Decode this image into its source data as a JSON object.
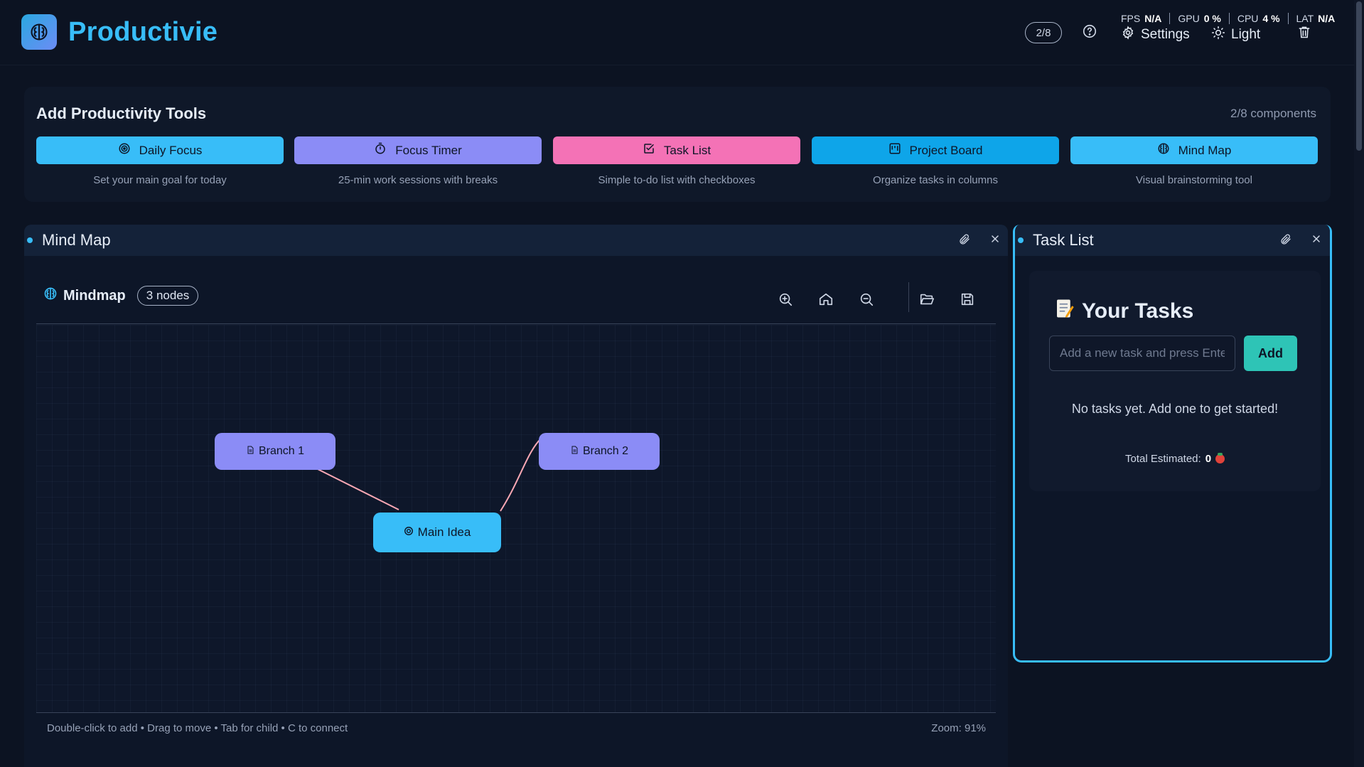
{
  "brand": {
    "name": "Productivie",
    "logo_icon": "brain-icon"
  },
  "topbar": {
    "count": "2/8",
    "help_icon": "question-circle-icon",
    "stats": [
      {
        "label": "FPS",
        "value": "N/A"
      },
      {
        "label": "GPU",
        "value": "0 %"
      },
      {
        "label": "CPU",
        "value": "4 %"
      },
      {
        "label": "LAT",
        "value": "N/A"
      }
    ],
    "settings_label": "Settings",
    "light_label": "Light",
    "trash_icon": "trash-icon"
  },
  "tools": {
    "title": "Add Productivity Tools",
    "count": "2/8 components",
    "items": [
      {
        "label": "Daily Focus",
        "desc": "Set your main goal for today",
        "icon": "target-icon",
        "color": "#38bdf8"
      },
      {
        "label": "Focus Timer",
        "desc": "25-min work sessions with breaks",
        "icon": "stopwatch-icon",
        "color": "#8b8cf6"
      },
      {
        "label": "Task List",
        "desc": "Simple to-do list with checkboxes",
        "icon": "checkbox-icon",
        "color": "#f472b6"
      },
      {
        "label": "Project Board",
        "desc": "Organize tasks in columns",
        "icon": "kanban-icon",
        "color": "#0ea5e9"
      },
      {
        "label": "Mind Map",
        "desc": "Visual brainstorming tool",
        "icon": "brain-icon",
        "color": "#38bdf8"
      }
    ]
  },
  "mindmap": {
    "panel_title": "Mind Map",
    "label": "Mindmap",
    "nodes_count": "3 nodes",
    "nodes": {
      "branch1": "Branch 1",
      "branch2": "Branch 2",
      "main": "Main Idea"
    },
    "hint": "Double-click to add • Drag to move • Tab for child • C to connect",
    "zoom": "Zoom: 91%",
    "edge_color": "#f9a8b4"
  },
  "tasklist": {
    "panel_title": "Task List",
    "heading": "Your Tasks",
    "input_placeholder": "Add a new task and press Enter",
    "input_value": "",
    "add_label": "Add",
    "empty_text": "No tasks yet. Add one to get started!",
    "total_label": "Total Estimated:",
    "total_value": "0"
  }
}
